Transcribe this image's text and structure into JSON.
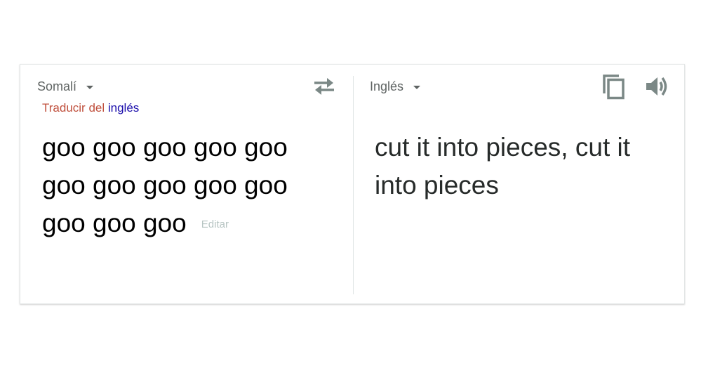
{
  "source": {
    "language": "Somalí",
    "detect_prefix": "Traducir del ",
    "detect_language": "inglés",
    "text": "goo goo goo goo goo goo goo goo goo goo goo goo goo",
    "edit_label": "Editar"
  },
  "target": {
    "language": "Inglés",
    "text": "cut it into pieces, cut it into pieces"
  },
  "icons": {
    "swap": "swap-arrows-icon",
    "copy": "copy-icon",
    "speak": "speaker-icon"
  },
  "colors": {
    "detect_prefix": "#c0503d",
    "detect_link": "#1a0dab",
    "icon": "#7b8886",
    "edit": "#b6c4c2"
  }
}
